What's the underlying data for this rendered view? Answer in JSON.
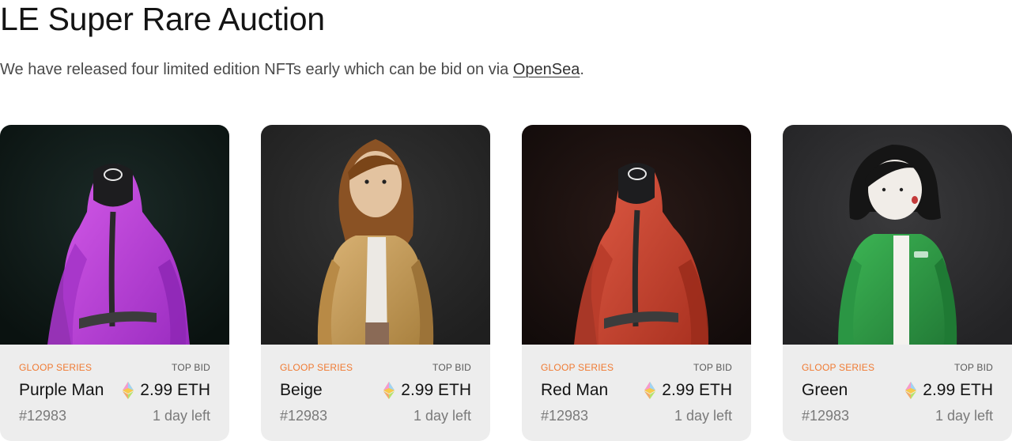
{
  "header": {
    "title": "LE Super Rare Auction",
    "subtitle_prefix": "We have released four limited edition NFTs early which can be bid on via ",
    "link_label": "OpenSea",
    "subtitle_suffix": "."
  },
  "cards": [
    {
      "series": "GLOOP SERIES",
      "top_bid_label": "TOP BID",
      "name": "Purple Man",
      "price": "2.99 ETH",
      "token": "#12983",
      "time_left": "1 day left",
      "image": "purple hooded guard character",
      "bg_color": "#0f1a18",
      "outfit_color": "#b43ad6"
    },
    {
      "series": "GLOOP SERIES",
      "top_bid_label": "TOP BID",
      "name": "Beige",
      "price": "2.99 ETH",
      "token": "#12983",
      "time_left": "1 day left",
      "image": "character with long brown hair in beige coat",
      "bg_color": "#2a2a2a",
      "outfit_color": "#caa062"
    },
    {
      "series": "GLOOP SERIES",
      "top_bid_label": "TOP BID",
      "name": "Red Man",
      "price": "2.99 ETH",
      "token": "#12983",
      "time_left": "1 day left",
      "image": "red hooded guard character",
      "bg_color": "#1a1110",
      "outfit_color": "#c94430"
    },
    {
      "series": "GLOOP SERIES",
      "top_bid_label": "TOP BID",
      "name": "Green",
      "price": "2.99 ETH",
      "token": "#12983",
      "time_left": "1 day left",
      "image": "character with black bob hair in green tracksuit",
      "bg_color": "#2c2c2e",
      "outfit_color": "#2f9a45"
    }
  ],
  "icons": {
    "currency": "ethereum-icon"
  },
  "colors": {
    "series_accent": "#f07a32",
    "card_bg": "#ededed"
  }
}
